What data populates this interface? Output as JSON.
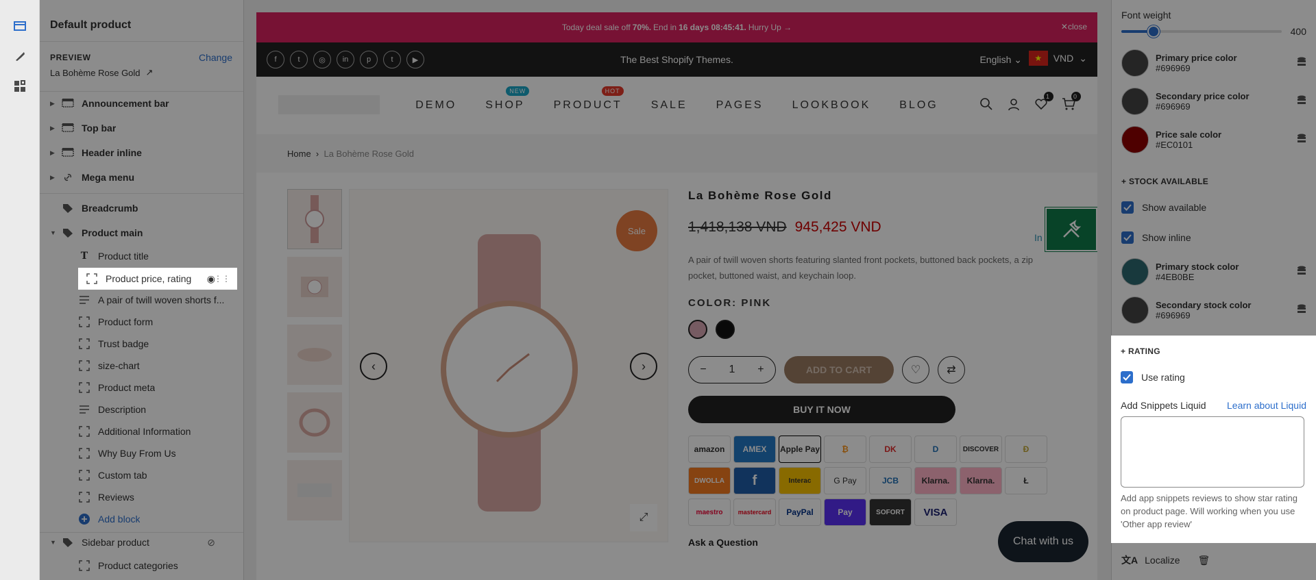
{
  "left_panel": {
    "title": "Default product",
    "preview_label": "PREVIEW",
    "change_label": "Change",
    "preview_value": "La Bohème Rose Gold",
    "sections": [
      {
        "label": "Announcement bar",
        "icon": "section-icon"
      },
      {
        "label": "Top bar",
        "icon": "section-icon"
      },
      {
        "label": "Header inline",
        "icon": "section-icon"
      },
      {
        "label": "Mega menu",
        "icon": "link-icon"
      },
      {
        "label": "Breadcrumb",
        "icon": "tag-icon"
      },
      {
        "label": "Product main",
        "icon": "tag-icon"
      }
    ],
    "blocks": [
      {
        "label": "Product title",
        "icon": "text-icon"
      },
      {
        "label": "Product price, rating",
        "icon": "block-icon"
      },
      {
        "label": "A pair of twill woven shorts f...",
        "icon": "paragraph-icon"
      },
      {
        "label": "Product form",
        "icon": "block-icon"
      },
      {
        "label": "Trust badge",
        "icon": "block-icon"
      },
      {
        "label": "size-chart",
        "icon": "block-icon"
      },
      {
        "label": "Product meta",
        "icon": "block-icon"
      },
      {
        "label": "Description",
        "icon": "paragraph-icon"
      },
      {
        "label": "Additional Information",
        "icon": "block-icon"
      },
      {
        "label": "Why Buy From Us",
        "icon": "block-icon"
      },
      {
        "label": "Custom tab",
        "icon": "block-icon"
      },
      {
        "label": "Reviews",
        "icon": "block-icon"
      }
    ],
    "add_block": "Add block",
    "sidebar_section": "Sidebar product",
    "sidebar_block": "Product categories"
  },
  "store": {
    "announcement": {
      "pre": "Today deal sale off",
      "pct": "70%.",
      "mid": "End in",
      "time": "16 days 08:45:41.",
      "post": "Hurry Up →",
      "close": "close"
    },
    "tagline": "The Best Shopify Themes.",
    "language": "English",
    "currency": "VND",
    "nav": [
      "DEMO",
      "SHOP",
      "PRODUCT",
      "SALE",
      "PAGES",
      "LOOKBOOK",
      "BLOG"
    ],
    "badges": {
      "shop": "NEW",
      "product": "HOT"
    },
    "wishlist_count": "1",
    "cart_count": "0",
    "breadcrumb": {
      "home": "Home",
      "current": "La Bohème Rose Gold"
    },
    "sale_badge": "Sale",
    "product": {
      "title": "La Bohème Rose Gold",
      "old_price": "1,418,138 VND",
      "new_price": "945,425 VND",
      "stock_partial": "In",
      "description": "A pair of twill woven shorts featuring slanted front pockets, buttoned back pockets, a zip pocket, buttoned waist, and keychain loop.",
      "color_label": "COLOR: PINK",
      "qty": "1",
      "add_to_cart": "ADD TO CART",
      "buy_now": "BUY IT NOW",
      "ask": "Ask a Question"
    },
    "payments": [
      "amazon",
      "AMEX",
      "Apple Pay",
      "₿",
      "DK",
      "D",
      "DISCOVER",
      "Ð",
      "DWOLLA",
      "f",
      "Interac",
      "G Pay",
      "JCB",
      "Klarna.",
      "Klarna.",
      "Ł",
      "maestro",
      "mastercard",
      "PayPal",
      "Pay",
      "SOFORT",
      "VISA"
    ],
    "chat": "Chat with us"
  },
  "right_panel": {
    "font_weight_label": "Font weight",
    "font_weight_value": "400",
    "font_weight_fraction": 0.2,
    "colors": [
      {
        "name": "Primary price color",
        "hex": "#696969"
      },
      {
        "name": "Secondary price color",
        "hex": "#696969"
      },
      {
        "name": "Price sale color",
        "hex": "#EC0101"
      }
    ],
    "stock_heading": "+ STOCK AVAILABLE",
    "show_available": "Show available",
    "show_inline": "Show inline",
    "stock_colors": [
      {
        "name": "Primary stock color",
        "hex": "#4EB0BE"
      },
      {
        "name": "Secondary stock color",
        "hex": "#696969"
      }
    ],
    "rating_heading": "+ RATING",
    "use_rating": "Use rating",
    "snippets_label": "Add Snippets Liquid",
    "learn_link": "Learn about Liquid",
    "help": "Add app snippets reviews to show star rating on product page. Will working when you use 'Other app review'",
    "localize": "Localize"
  }
}
